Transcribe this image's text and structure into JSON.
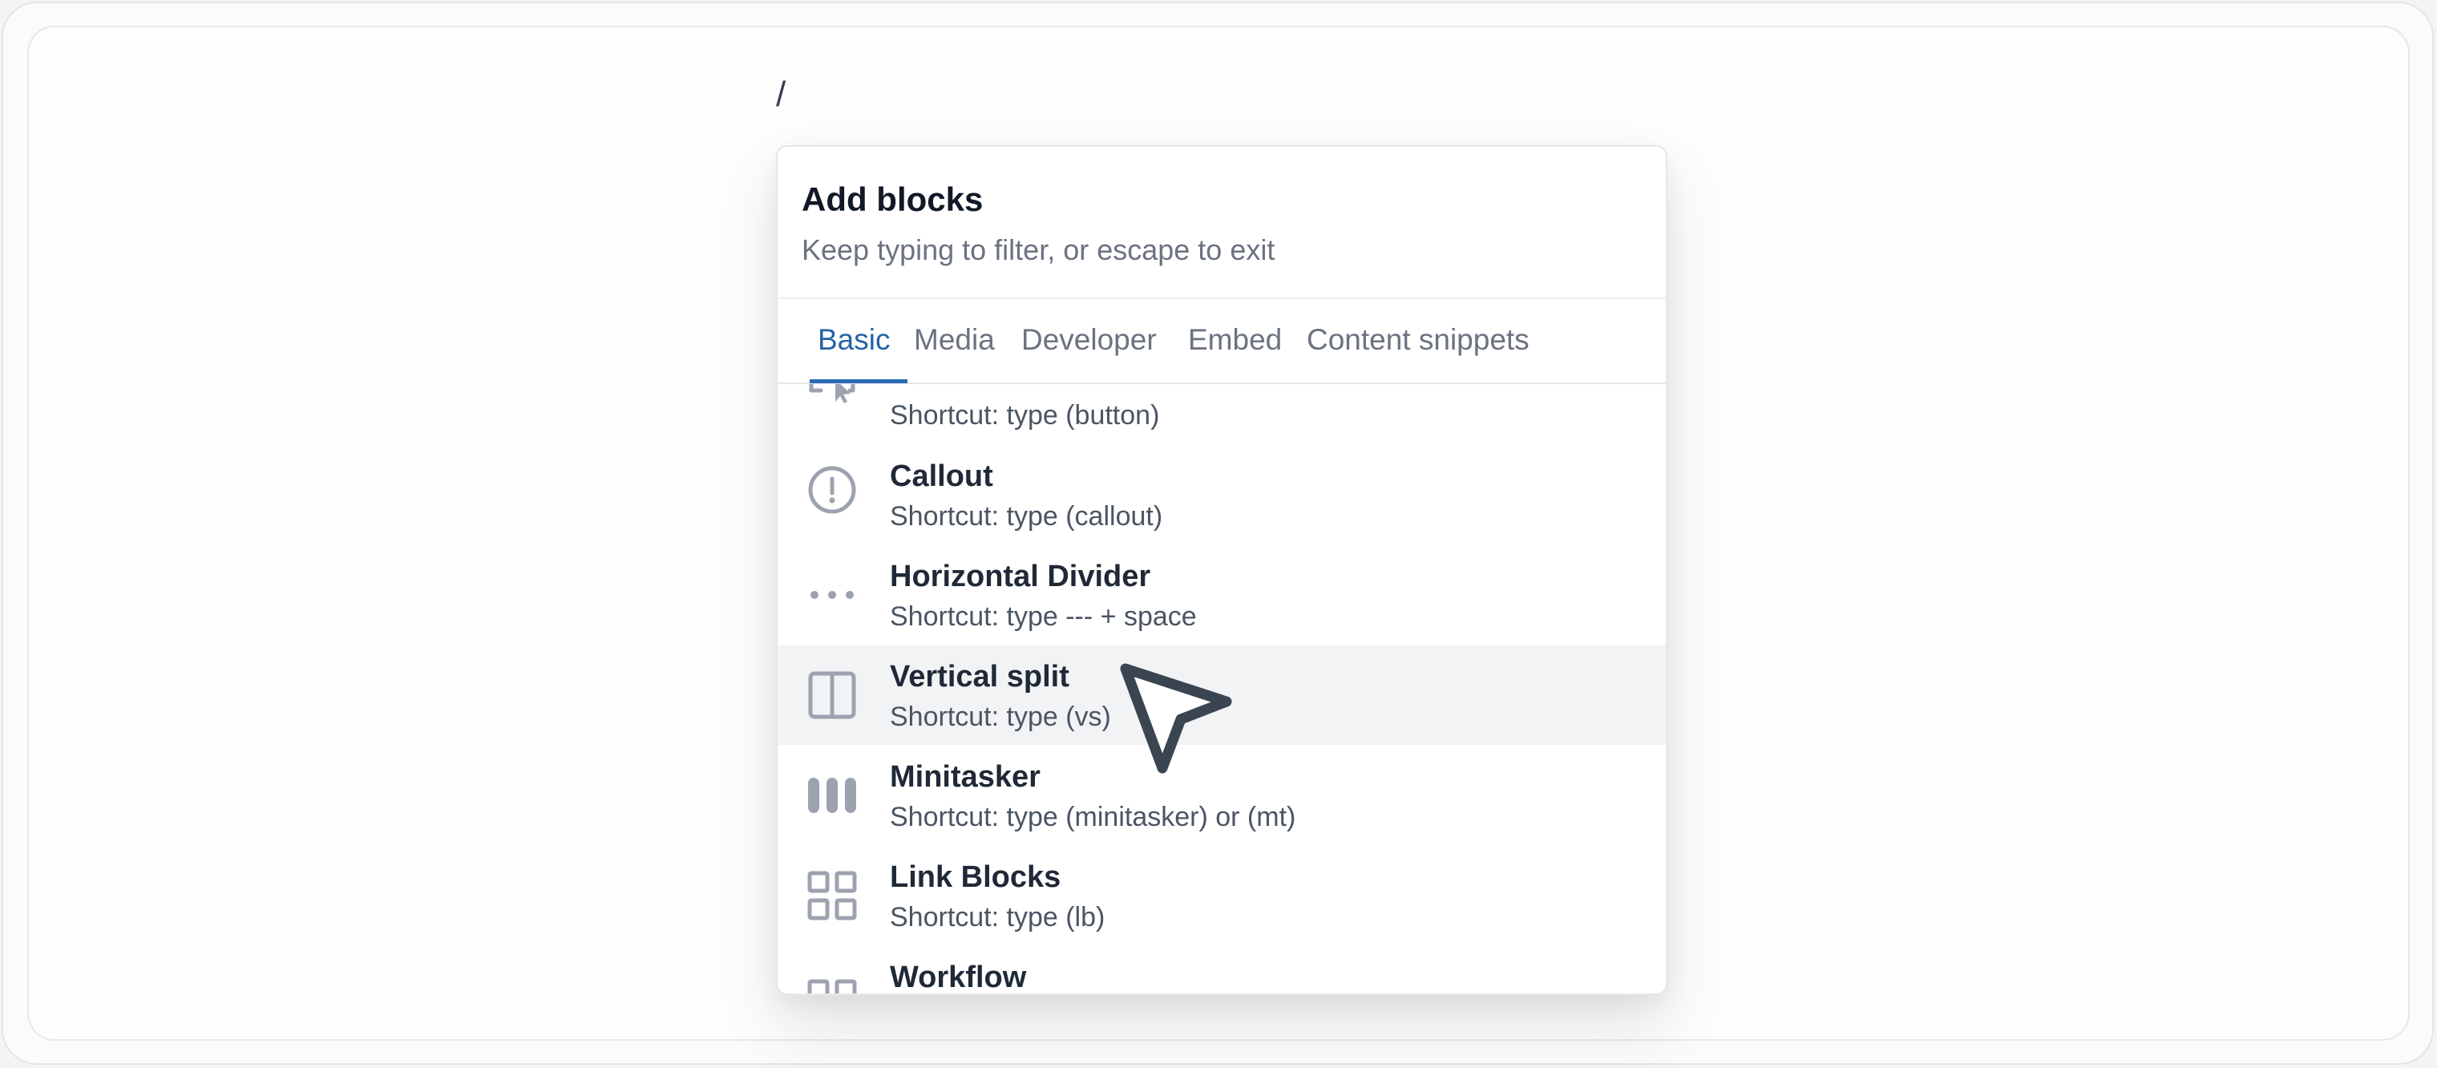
{
  "editor": {
    "typed_text": "/"
  },
  "panel": {
    "title": "Add blocks",
    "subtitle": "Keep typing to filter, or escape to exit"
  },
  "tabs": [
    {
      "label": "Basic",
      "active": true
    },
    {
      "label": "Media",
      "active": false
    },
    {
      "label": "Developer",
      "active": false
    },
    {
      "label": "Embed",
      "active": false
    },
    {
      "label": "Content snippets",
      "active": false
    }
  ],
  "items": [
    {
      "title": "",
      "shortcut": "Shortcut: type (button)",
      "icon": "button-cursor-icon"
    },
    {
      "title": "Callout",
      "shortcut": "Shortcut: type (callout)",
      "icon": "exclamation-circle-icon"
    },
    {
      "title": "Horizontal Divider",
      "shortcut": "Shortcut: type --- + space",
      "icon": "ellipsis-icon"
    },
    {
      "title": "Vertical split",
      "shortcut": "Shortcut: type (vs)",
      "icon": "vertical-split-icon",
      "highlighted": true
    },
    {
      "title": "Minitasker",
      "shortcut": "Shortcut: type (minitasker) or (mt)",
      "icon": "columns-bars-icon"
    },
    {
      "title": "Link Blocks",
      "shortcut": "Shortcut: type (lb)",
      "icon": "grid-icon"
    },
    {
      "title": "Workflow",
      "shortcut": "",
      "icon": "grid-icon"
    }
  ],
  "colors": {
    "accent": "#2563a6",
    "highlight_row": "#f2f3f5",
    "icon_gray": "#9ca3af"
  }
}
